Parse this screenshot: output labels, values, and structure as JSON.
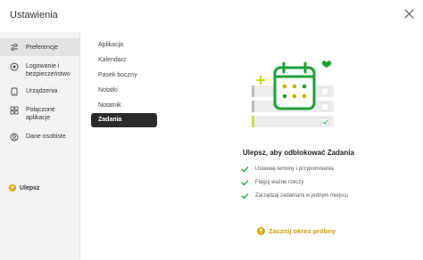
{
  "window": {
    "title": "Ustawienia"
  },
  "sidebar": {
    "items": [
      {
        "label": "Preferencje",
        "icon": "sliders-icon",
        "active": true
      },
      {
        "label": "Logowanie i\nbezpieczeństwo",
        "icon": "shield-icon"
      },
      {
        "label": "Urządzenia",
        "icon": "device-icon"
      },
      {
        "label": "Połączone\naplikacje",
        "icon": "apps-icon"
      },
      {
        "label": "Dane osobiste",
        "icon": "person-icon"
      }
    ],
    "upgrade_label": "Ulepsz"
  },
  "submenu": {
    "items": [
      {
        "label": "Aplikacja"
      },
      {
        "label": "Kalendarz"
      },
      {
        "label": "Pasek boczny"
      },
      {
        "label": "Notatki"
      },
      {
        "label": "Notatnik"
      },
      {
        "label": "Zadania",
        "active": true
      }
    ]
  },
  "main": {
    "headline": "Ulepsz, aby odblokować Zadania",
    "features": [
      "Ustawiaj terminy i przypomnienia",
      "Flaguj ważne rzeczy",
      "Zarządzaj zadaniami w jednym miejscu"
    ],
    "trial_label": "Zacznij okres próbny"
  },
  "colors": {
    "accent_green": "#1f9e3a",
    "accent_gold": "#e0a800",
    "active_dark": "#2b2b2b"
  }
}
